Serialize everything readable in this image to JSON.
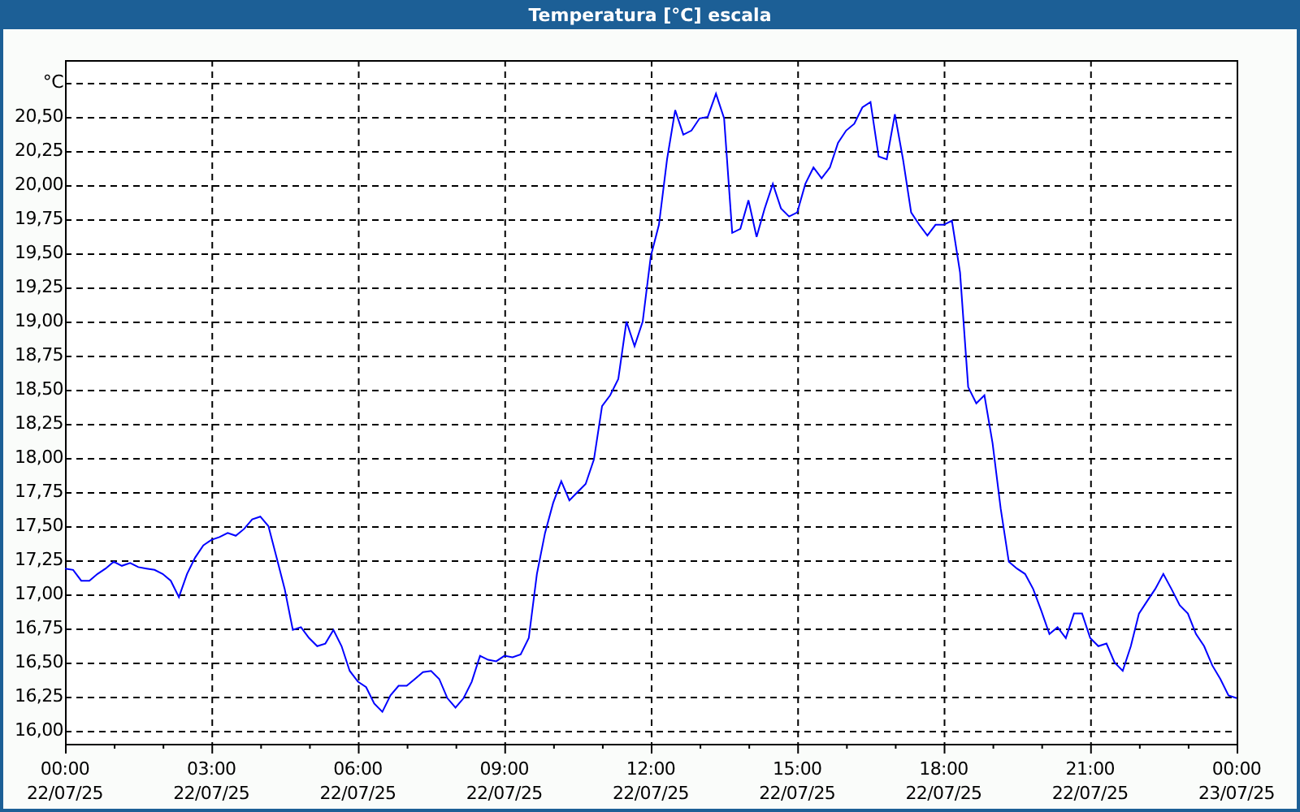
{
  "window": {
    "title": "Temperatura [°C] escala"
  },
  "chart": {
    "chart_data": {
      "type": "line",
      "grid": true,
      "ylim": [
        15.905,
        20.917
      ],
      "yticks": [
        {
          "value": 16,
          "label": "16,00"
        },
        {
          "value": 16.25,
          "label": "16,25"
        },
        {
          "value": 16.5,
          "label": "16,50"
        },
        {
          "value": 16.75,
          "label": "16,75"
        },
        {
          "value": 17,
          "label": "17,00"
        },
        {
          "value": 17.25,
          "label": "17,25"
        },
        {
          "value": 17.5,
          "label": "17,50"
        },
        {
          "value": 17.75,
          "label": "17,75"
        },
        {
          "value": 18,
          "label": "18,00"
        },
        {
          "value": 18.25,
          "label": "18,25"
        },
        {
          "value": 18.5,
          "label": "18,50"
        },
        {
          "value": 18.75,
          "label": "18,75"
        },
        {
          "value": 19,
          "label": "19,00"
        },
        {
          "value": 19.25,
          "label": "19,25"
        },
        {
          "value": 19.5,
          "label": "19,50"
        },
        {
          "value": 19.75,
          "label": "19,75"
        },
        {
          "value": 20,
          "label": "20,00"
        },
        {
          "value": 20.25,
          "label": "20,25"
        },
        {
          "value": 20.5,
          "label": "20,50"
        },
        {
          "value": 20.75,
          "label": "°C"
        }
      ],
      "categories": [
        "00:00 22/07/25",
        null,
        null,
        null,
        null,
        null,
        null,
        null,
        null,
        null,
        null,
        null,
        null,
        null,
        null,
        null,
        null,
        null,
        "03:00 22/07/25",
        null,
        null,
        null,
        null,
        null,
        null,
        null,
        null,
        null,
        null,
        null,
        null,
        null,
        null,
        null,
        null,
        null,
        "06:00 22/07/25",
        null,
        null,
        null,
        null,
        null,
        null,
        null,
        null,
        null,
        null,
        null,
        null,
        null,
        null,
        null,
        null,
        null,
        "09:00 22/07/25",
        null,
        null,
        null,
        null,
        null,
        null,
        null,
        null,
        null,
        null,
        null,
        null,
        null,
        null,
        null,
        null,
        null,
        "12:00 22/07/25",
        null,
        null,
        null,
        null,
        null,
        null,
        null,
        null,
        null,
        null,
        null,
        null,
        null,
        null,
        null,
        null,
        null,
        "15:00 22/07/25",
        null,
        null,
        null,
        null,
        null,
        null,
        null,
        null,
        null,
        null,
        null,
        null,
        null,
        null,
        null,
        null,
        null,
        "18:00 22/07/25",
        null,
        null,
        null,
        null,
        null,
        null,
        null,
        null,
        null,
        null,
        null,
        null,
        null,
        null,
        null,
        null,
        null,
        "21:00 22/07/25",
        null,
        null,
        null,
        null,
        null,
        null,
        null,
        null,
        null,
        null,
        null,
        null,
        null,
        null,
        null,
        null,
        null,
        "00:00 23/07/25"
      ],
      "series": [
        {
          "color": "#0000ff",
          "values": [
            17.19,
            17.18,
            17.1,
            17.1,
            17.15,
            17.19,
            17.24,
            17.21,
            17.23,
            17.2,
            17.19,
            17.18,
            17.15,
            17.1,
            16.98,
            17.15,
            17.27,
            17.36,
            17.4,
            17.42,
            17.45,
            17.43,
            17.48,
            17.55,
            17.57,
            17.5,
            17.27,
            17.04,
            16.74,
            16.76,
            16.68,
            16.62,
            16.64,
            16.74,
            16.62,
            16.44,
            16.36,
            16.32,
            16.2,
            16.14,
            16.26,
            16.33,
            16.33,
            16.38,
            16.43,
            16.44,
            16.38,
            16.24,
            16.17,
            16.24,
            16.36,
            16.55,
            16.52,
            16.51,
            16.55,
            16.54,
            16.56,
            16.68,
            17.15,
            17.45,
            17.67,
            17.83,
            17.69,
            17.75,
            17.81,
            17.99,
            18.38,
            18.46,
            18.58,
            19.0,
            18.82,
            19.0,
            19.48,
            19.71,
            20.19,
            20.55,
            20.37,
            20.4,
            20.49,
            20.5,
            20.67,
            20.49,
            19.65,
            19.68,
            19.89,
            19.62,
            19.83,
            20.01,
            19.83,
            19.77,
            19.8,
            20.01,
            20.13,
            20.05,
            20.13,
            20.31,
            20.4,
            20.45,
            20.57,
            20.61,
            20.21,
            20.19,
            20.52,
            20.19,
            19.8,
            19.71,
            19.63,
            19.71,
            19.71,
            19.74,
            19.36,
            18.52,
            18.4,
            18.46,
            18.11,
            17.63,
            17.24,
            17.19,
            17.15,
            17.04,
            16.88,
            16.71,
            16.76,
            16.68,
            16.86,
            16.86,
            16.68,
            16.62,
            16.64,
            16.5,
            16.44,
            16.62,
            16.86,
            16.95,
            17.04,
            17.15,
            17.04,
            16.92,
            16.86,
            16.71,
            16.62,
            16.48,
            16.38,
            16.26,
            16.24
          ]
        }
      ]
    }
  }
}
